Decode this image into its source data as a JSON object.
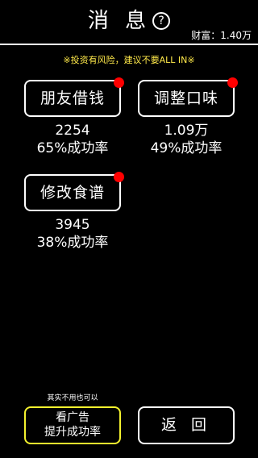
{
  "header": {
    "title": "消 息",
    "help_icon": "?",
    "wealth": "财富：1.40万"
  },
  "warning": "※投资有风险，建议不要ALL IN※",
  "cards": [
    {
      "label": "朋友借钱",
      "amount": "2254",
      "rate": "65%成功率",
      "has_notification": true
    },
    {
      "label": "调整口味",
      "amount": "1.09万",
      "rate": "49%成功率",
      "has_notification": true
    },
    {
      "label": "修改食谱",
      "amount": "3945",
      "rate": "38%成功率",
      "has_notification": true
    }
  ],
  "footer": {
    "ad_hint": "其实不用也可以",
    "ad_button_line1": "看广告",
    "ad_button_line2": "提升成功率",
    "back_label": "返 回"
  },
  "colors": {
    "background": "#000000",
    "warning": "#ffe94a",
    "notification_dot": "#ff0000",
    "ad_button_border": "#f4f22e"
  }
}
